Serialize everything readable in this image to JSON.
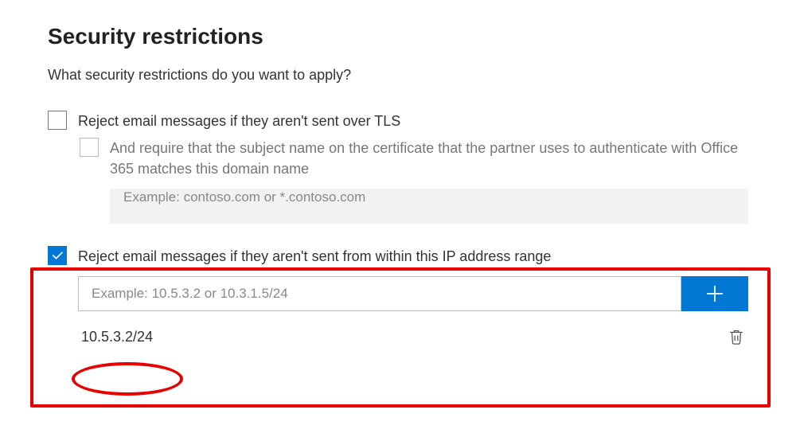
{
  "header": {
    "title": "Security restrictions",
    "subtitle": "What security restrictions do you want to apply?"
  },
  "options": {
    "tls": {
      "checked": false,
      "label": "Reject email messages if they aren't sent over TLS"
    },
    "certSubject": {
      "checked": false,
      "enabled": false,
      "label": "And require that the subject name on the certificate that the partner uses to authenticate with Office 365 matches this domain name",
      "placeholder": "Example: contoso.com or *.contoso.com"
    },
    "ipRange": {
      "checked": true,
      "label": "Reject email messages if they aren't sent from within this IP address range",
      "placeholder": "Example: 10.5.3.2 or 10.3.1.5/24",
      "entries": [
        "10.5.3.2/24"
      ]
    }
  },
  "colors": {
    "accent": "#0078d4",
    "annotation": "#e60000"
  }
}
